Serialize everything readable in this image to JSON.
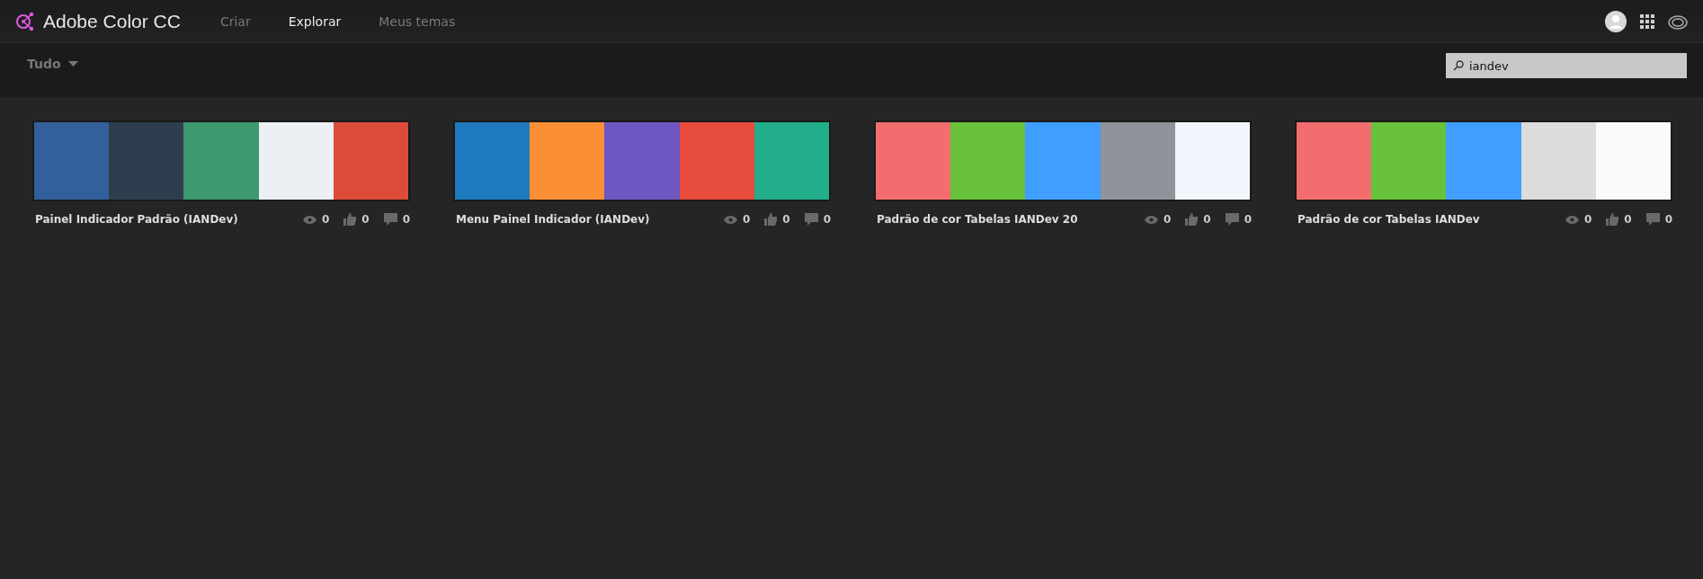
{
  "app": {
    "title": "Adobe Color CC"
  },
  "nav": [
    {
      "label": "Criar",
      "selected": false
    },
    {
      "label": "Explorar",
      "selected": true
    },
    {
      "label": "Meus temas",
      "selected": false
    }
  ],
  "filter": {
    "label": "Tudo"
  },
  "search": {
    "value": "iandev"
  },
  "themes": [
    {
      "name": "Painel Indicador Padrão (IANDev)",
      "views": "0",
      "likes": "0",
      "comments": "0",
      "swatches": [
        {
          "color": "#31609a"
        },
        {
          "color": "#2e3e4f"
        },
        {
          "color": "#3d9970"
        },
        {
          "color": "#ecf0f5"
        },
        {
          "color": "#dd4b39"
        }
      ]
    },
    {
      "name": "Menu Painel Indicador (IANDev)",
      "views": "0",
      "likes": "0",
      "comments": "0",
      "swatches": [
        {
          "color": "#1f7bbd"
        },
        {
          "color": "#fb8f35"
        },
        {
          "color": "#6e57c0"
        },
        {
          "color": "#e74c3c"
        },
        {
          "color": "#22ae8a"
        }
      ]
    },
    {
      "name": "Padrão de cor Tabelas IANDev 20",
      "views": "0",
      "likes": "0",
      "comments": "0",
      "swatches": [
        {
          "color": "#f46d6e"
        },
        {
          "color": "#67c23a"
        },
        {
          "color": "#409eff"
        },
        {
          "color": "#909399"
        },
        {
          "color": "#f2f6fc"
        }
      ]
    },
    {
      "name": "Padrão de cor Tabelas IANDev",
      "views": "0",
      "likes": "0",
      "comments": "0",
      "swatches": [
        {
          "color": "#f46d6e"
        },
        {
          "color": "#67c23a"
        },
        {
          "color": "#409eff"
        },
        {
          "color": "#dcdcdc"
        },
        {
          "color": "#fafafa"
        }
      ]
    }
  ]
}
